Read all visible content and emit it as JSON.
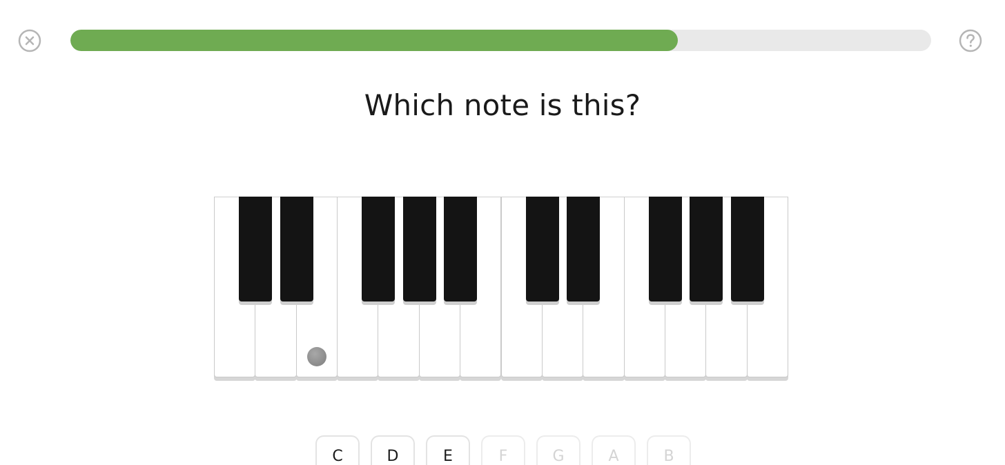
{
  "header": {
    "close_icon": "close-circle-icon",
    "help_icon": "question-circle-icon",
    "progress_fraction": 0.706,
    "progress_color": "#6fab52",
    "track_color": "#e9e9e9"
  },
  "question": {
    "text": "Which note is this?"
  },
  "piano": {
    "white_key_count": 14,
    "black_key_positions_after_white": [
      0,
      1,
      3,
      4,
      5,
      7,
      8,
      10,
      11,
      12
    ],
    "marked_white_key_index": 2,
    "marker_color": "#999999"
  },
  "answers": [
    {
      "label": "C",
      "enabled": true
    },
    {
      "label": "D",
      "enabled": true
    },
    {
      "label": "E",
      "enabled": true
    },
    {
      "label": "F",
      "enabled": false
    },
    {
      "label": "G",
      "enabled": false
    },
    {
      "label": "A",
      "enabled": false
    },
    {
      "label": "B",
      "enabled": false
    }
  ]
}
